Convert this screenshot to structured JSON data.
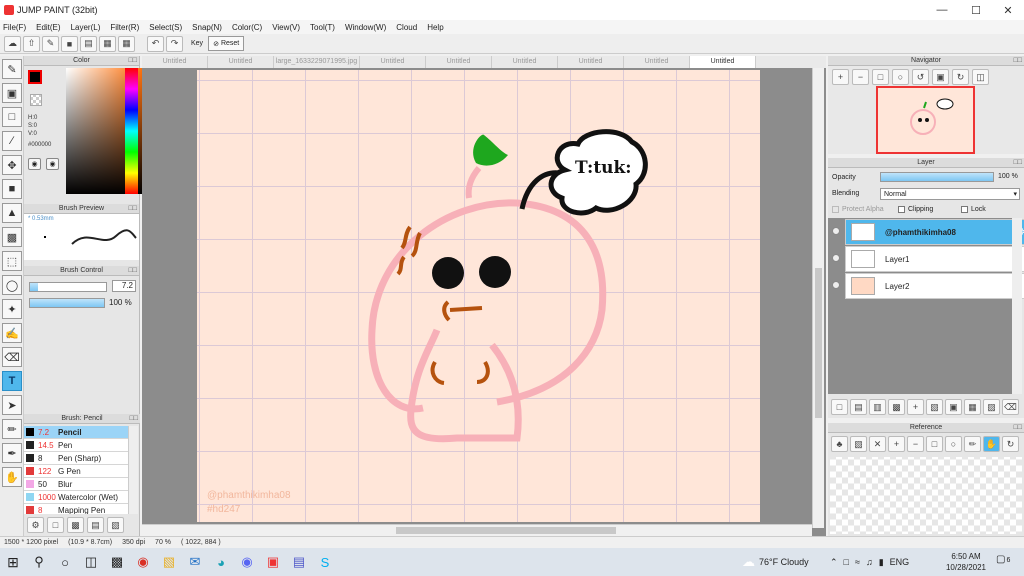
{
  "window": {
    "title": "JUMP PAINT (32bit)"
  },
  "menu": [
    "File(F)",
    "Edit(E)",
    "Layer(L)",
    "Filter(R)",
    "Select(S)",
    "Snap(N)",
    "Color(C)",
    "View(V)",
    "Tool(T)",
    "Window(W)",
    "Cloud",
    "Help"
  ],
  "toolbar": {
    "key_label": "Key",
    "reset_label": "Reset"
  },
  "color_panel": {
    "title": "Color",
    "h": "H:0",
    "s": "S:0",
    "v": "V:0",
    "hex": "#000000",
    "fg": "#000000"
  },
  "brush_preview": {
    "title": "Brush Preview",
    "size": "* 0.53mm"
  },
  "brush_control": {
    "title": "Brush Control",
    "size_value": "7.2",
    "opacity_value": "100 %"
  },
  "brush_list": {
    "title": "Brush: Pencil",
    "items": [
      {
        "size": "7.2",
        "name": "Pencil",
        "color": "#000000"
      },
      {
        "size": "14.5",
        "name": "Pen",
        "color": "#222222"
      },
      {
        "size": "8",
        "name": "Pen (Sharp)",
        "color": "#222222"
      },
      {
        "size": "122",
        "name": "G Pen",
        "color": "#e23a3a"
      },
      {
        "size": "50",
        "name": "Blur",
        "color": "#f3a8e6"
      },
      {
        "size": "1000",
        "name": "Watercolor (Wet)",
        "color": "#8fd6f2"
      },
      {
        "size": "8",
        "name": "Mapping Pen",
        "color": "#e23a3a"
      }
    ]
  },
  "tabs": [
    "Untitled",
    "Untitled",
    "large_1633229071995.jpg",
    "Untitled",
    "Untitled",
    "Untitled",
    "Untitled",
    "Untitled",
    "Untitled"
  ],
  "canvas": {
    "speech_text": "T:tuk:",
    "watermark_line1": "@phamthikimha08",
    "watermark_line2": "#hd247"
  },
  "navigator": {
    "title": "Navigator"
  },
  "layer_panel": {
    "title": "Layer",
    "opacity_label": "Opacity",
    "opacity_value": "100 %",
    "blending_label": "Blending",
    "blending_value": "Normal",
    "protect_alpha": "Protect Alpha",
    "clipping": "Clipping",
    "lock": "Lock",
    "layers": [
      {
        "name": "@phamthikimha08"
      },
      {
        "name": "Layer1"
      },
      {
        "name": "Layer2"
      }
    ]
  },
  "reference": {
    "title": "Reference"
  },
  "status": {
    "dimensions": "1500 * 1200 pixel",
    "physical": "(10.9 * 8.7cm)",
    "dpi": "350 dpi",
    "zoom": "70 %",
    "coords": "( 1022, 884 )"
  },
  "taskbar": {
    "weather": "76°F  Cloudy",
    "lang": "ENG",
    "time": "6:50 AM",
    "date": "10/28/2021",
    "notif_count": "6"
  }
}
